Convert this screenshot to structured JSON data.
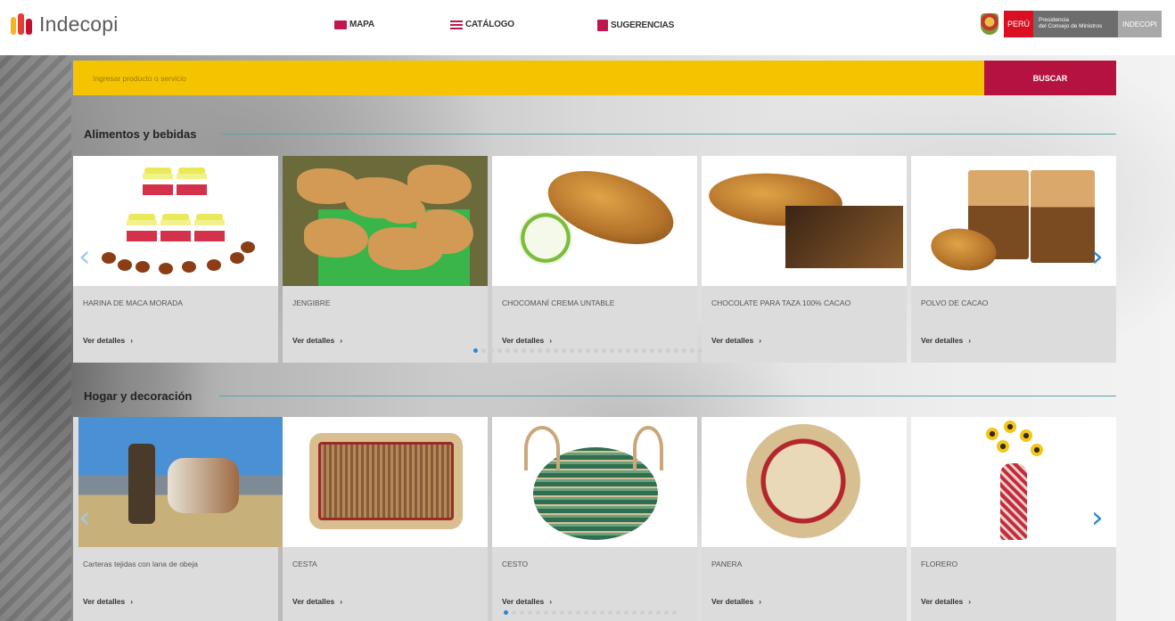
{
  "header": {
    "logo_text": "Indecopi",
    "nav": [
      {
        "label": "MAPA",
        "icon": "map-icon"
      },
      {
        "label": "CATÁLOGO",
        "icon": "menu-icon"
      },
      {
        "label": "SUGERENCIAS",
        "icon": "suggestion-icon"
      }
    ],
    "gov": {
      "peru": "PERÚ",
      "presidencia_line1": "Presidencia",
      "presidencia_line2": "del Consejo de Ministros",
      "indecopi": "INDECOPI"
    }
  },
  "search": {
    "placeholder": "Ingresar producto o servicio",
    "button_label": "BUSCAR"
  },
  "colors": {
    "search_bar": "#f5c400",
    "search_button": "#b5123f",
    "accent": "#c0174e",
    "carousel_arrow": "#2a86d6"
  },
  "sections": [
    {
      "title": "Alimentos y bebidas",
      "products": [
        {
          "name": "HARINA DE MACA MORADA",
          "link": "Ver detalles"
        },
        {
          "name": "JENGIBRE",
          "link": "Ver detalles"
        },
        {
          "name": "CHOCOMANÍ CREMA UNTABLE",
          "link": "Ver detalles"
        },
        {
          "name": "CHOCOLATE PARA TAZA 100% CACAO",
          "link": "Ver detalles"
        },
        {
          "name": "POLVO DE CACAO",
          "link": "Ver detalles"
        }
      ]
    },
    {
      "title": "Hogar y decoración",
      "products": [
        {
          "name": "Carteras tejidas con lana de obeja",
          "link": "Ver detalles"
        },
        {
          "name": "CESTA",
          "link": "Ver detalles"
        },
        {
          "name": "CESTO",
          "link": "Ver detalles"
        },
        {
          "name": "PANERA",
          "link": "Ver detalles"
        },
        {
          "name": "FLORERO",
          "link": "Ver detalles"
        }
      ]
    }
  ]
}
